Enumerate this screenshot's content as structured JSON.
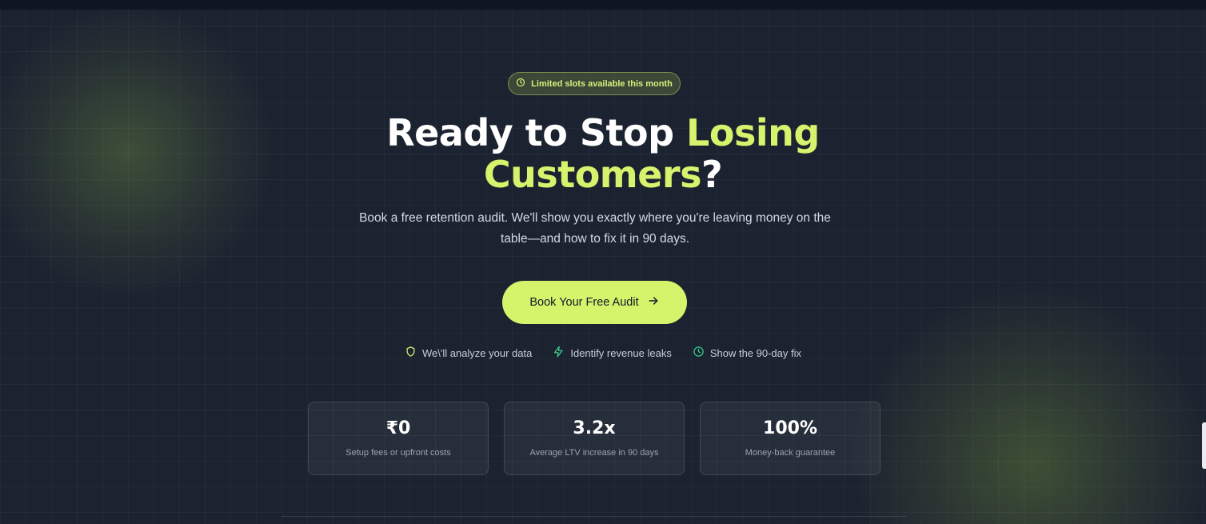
{
  "badge": {
    "label": "Limited slots available this month",
    "icon": "clock-icon"
  },
  "headline": {
    "part1": "Ready to Stop ",
    "accent1": "Losing",
    "accent2": "Customers",
    "part2": "?"
  },
  "subtitle": "Book a free retention audit. We'll show you exactly where you're leaving money on the table—and how to fix it in 90 days.",
  "cta": {
    "label": "Book Your Free Audit",
    "icon": "arrow-right-icon"
  },
  "features": [
    {
      "label": "We\\'ll analyze your data",
      "icon": "shield-icon"
    },
    {
      "label": "Identify revenue leaks",
      "icon": "lightning-icon"
    },
    {
      "label": "Show the 90-day fix",
      "icon": "clock-icon"
    }
  ],
  "stats": [
    {
      "value": "₹0",
      "label": "Setup fees or upfront costs"
    },
    {
      "value": "3.2x",
      "label": "Average LTV increase in 90 days"
    },
    {
      "value": "100%",
      "label": "Money-back guarantee"
    }
  ],
  "colors": {
    "accent": "#d4f46c",
    "background": "#1b2230",
    "shield": "#d4f46c",
    "lightning": "#3ccf8e",
    "clock": "#3ccf8e"
  }
}
